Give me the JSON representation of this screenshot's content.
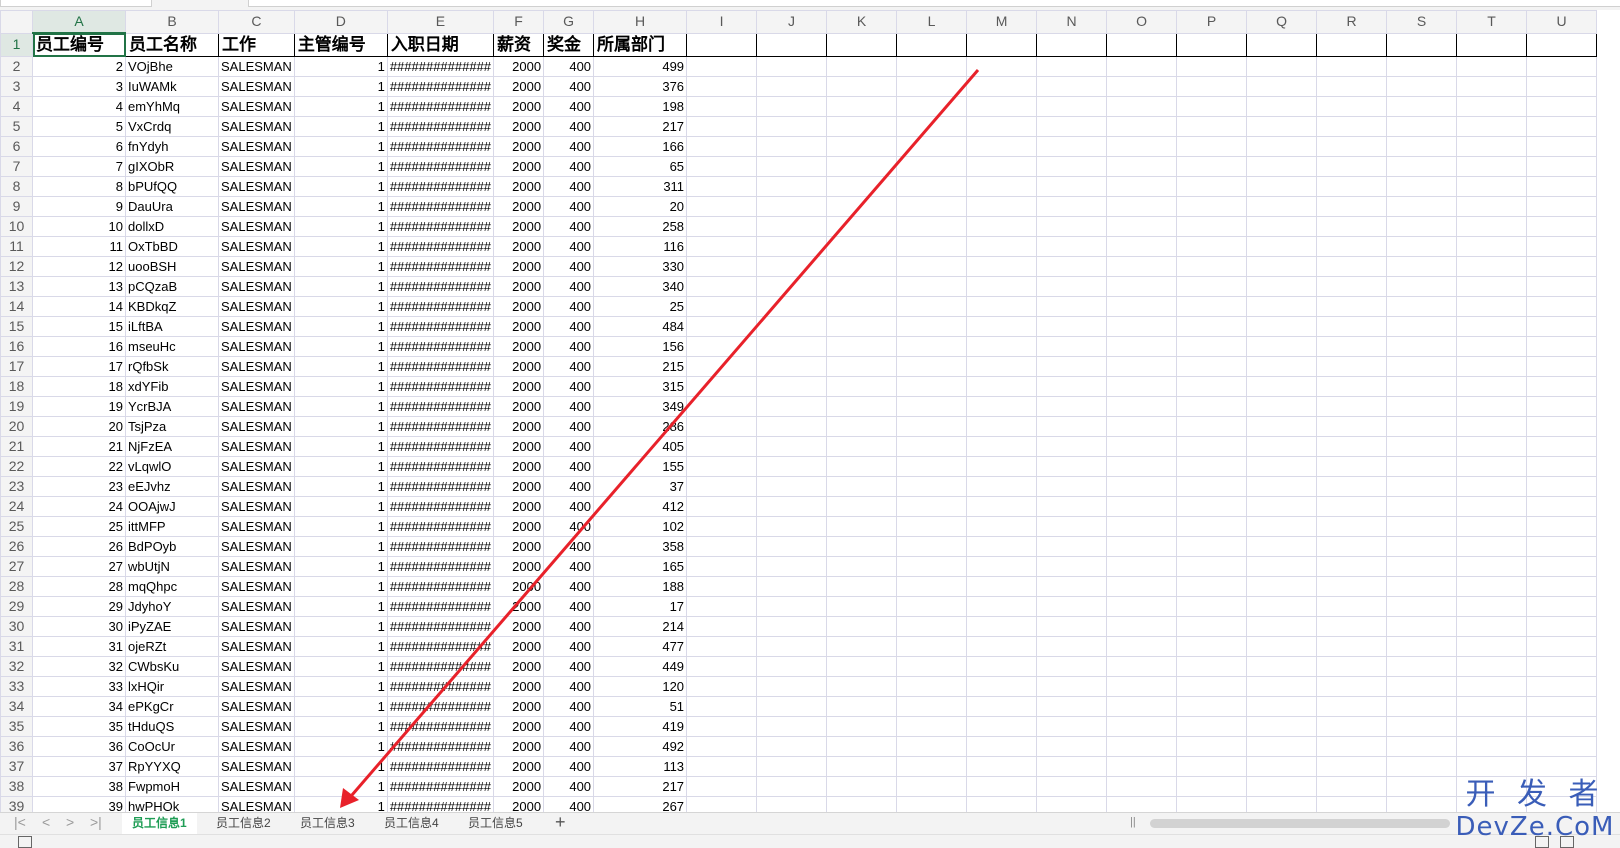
{
  "columns": [
    "A",
    "B",
    "C",
    "D",
    "E",
    "F",
    "G",
    "H",
    "I",
    "J",
    "K",
    "L",
    "M",
    "N",
    "O",
    "P",
    "Q",
    "R",
    "S",
    "T",
    "U"
  ],
  "selected_column": "A",
  "selected_row": "1",
  "header_row": [
    "员工编号",
    "员工名称",
    "工作",
    "主管编号",
    "入职日期",
    "薪资",
    "奖金",
    "所属部门"
  ],
  "rows": [
    {
      "id": "2",
      "name": "VOjBhe",
      "job": "SALESMAN",
      "mgr": "1",
      "date": "##############",
      "sal": "2000",
      "comm": "400",
      "dept": "499"
    },
    {
      "id": "3",
      "name": "IuWAMk",
      "job": "SALESMAN",
      "mgr": "1",
      "date": "##############",
      "sal": "2000",
      "comm": "400",
      "dept": "376"
    },
    {
      "id": "4",
      "name": "emYhMq",
      "job": "SALESMAN",
      "mgr": "1",
      "date": "##############",
      "sal": "2000",
      "comm": "400",
      "dept": "198"
    },
    {
      "id": "5",
      "name": "VxCrdq",
      "job": "SALESMAN",
      "mgr": "1",
      "date": "##############",
      "sal": "2000",
      "comm": "400",
      "dept": "217"
    },
    {
      "id": "6",
      "name": "fnYdyh",
      "job": "SALESMAN",
      "mgr": "1",
      "date": "##############",
      "sal": "2000",
      "comm": "400",
      "dept": "166"
    },
    {
      "id": "7",
      "name": "gIXObR",
      "job": "SALESMAN",
      "mgr": "1",
      "date": "##############",
      "sal": "2000",
      "comm": "400",
      "dept": "65"
    },
    {
      "id": "8",
      "name": "bPUfQQ",
      "job": "SALESMAN",
      "mgr": "1",
      "date": "##############",
      "sal": "2000",
      "comm": "400",
      "dept": "311"
    },
    {
      "id": "9",
      "name": "DauUra",
      "job": "SALESMAN",
      "mgr": "1",
      "date": "##############",
      "sal": "2000",
      "comm": "400",
      "dept": "20"
    },
    {
      "id": "10",
      "name": "dollxD",
      "job": "SALESMAN",
      "mgr": "1",
      "date": "##############",
      "sal": "2000",
      "comm": "400",
      "dept": "258"
    },
    {
      "id": "11",
      "name": "OxTbBD",
      "job": "SALESMAN",
      "mgr": "1",
      "date": "##############",
      "sal": "2000",
      "comm": "400",
      "dept": "116"
    },
    {
      "id": "12",
      "name": "uooBSH",
      "job": "SALESMAN",
      "mgr": "1",
      "date": "##############",
      "sal": "2000",
      "comm": "400",
      "dept": "330"
    },
    {
      "id": "13",
      "name": "pCQzaB",
      "job": "SALESMAN",
      "mgr": "1",
      "date": "##############",
      "sal": "2000",
      "comm": "400",
      "dept": "340"
    },
    {
      "id": "14",
      "name": "KBDkqZ",
      "job": "SALESMAN",
      "mgr": "1",
      "date": "##############",
      "sal": "2000",
      "comm": "400",
      "dept": "25"
    },
    {
      "id": "15",
      "name": "iLftBA",
      "job": "SALESMAN",
      "mgr": "1",
      "date": "##############",
      "sal": "2000",
      "comm": "400",
      "dept": "484"
    },
    {
      "id": "16",
      "name": "mseuHc",
      "job": "SALESMAN",
      "mgr": "1",
      "date": "##############",
      "sal": "2000",
      "comm": "400",
      "dept": "156"
    },
    {
      "id": "17",
      "name": "rQfbSk",
      "job": "SALESMAN",
      "mgr": "1",
      "date": "##############",
      "sal": "2000",
      "comm": "400",
      "dept": "215"
    },
    {
      "id": "18",
      "name": "xdYFib",
      "job": "SALESMAN",
      "mgr": "1",
      "date": "##############",
      "sal": "2000",
      "comm": "400",
      "dept": "315"
    },
    {
      "id": "19",
      "name": "YcrBJA",
      "job": "SALESMAN",
      "mgr": "1",
      "date": "##############",
      "sal": "2000",
      "comm": "400",
      "dept": "349"
    },
    {
      "id": "20",
      "name": "TsjPza",
      "job": "SALESMAN",
      "mgr": "1",
      "date": "##############",
      "sal": "2000",
      "comm": "400",
      "dept": "286"
    },
    {
      "id": "21",
      "name": "NjFzEA",
      "job": "SALESMAN",
      "mgr": "1",
      "date": "##############",
      "sal": "2000",
      "comm": "400",
      "dept": "405"
    },
    {
      "id": "22",
      "name": "vLqwlO",
      "job": "SALESMAN",
      "mgr": "1",
      "date": "##############",
      "sal": "2000",
      "comm": "400",
      "dept": "155"
    },
    {
      "id": "23",
      "name": "eEJvhz",
      "job": "SALESMAN",
      "mgr": "1",
      "date": "##############",
      "sal": "2000",
      "comm": "400",
      "dept": "37"
    },
    {
      "id": "24",
      "name": "OOAjwJ",
      "job": "SALESMAN",
      "mgr": "1",
      "date": "##############",
      "sal": "2000",
      "comm": "400",
      "dept": "412"
    },
    {
      "id": "25",
      "name": "ittMFP",
      "job": "SALESMAN",
      "mgr": "1",
      "date": "##############",
      "sal": "2000",
      "comm": "400",
      "dept": "102"
    },
    {
      "id": "26",
      "name": "BdPOyb",
      "job": "SALESMAN",
      "mgr": "1",
      "date": "##############",
      "sal": "2000",
      "comm": "400",
      "dept": "358"
    },
    {
      "id": "27",
      "name": "wbUtjN",
      "job": "SALESMAN",
      "mgr": "1",
      "date": "##############",
      "sal": "2000",
      "comm": "400",
      "dept": "165"
    },
    {
      "id": "28",
      "name": "mqQhpc",
      "job": "SALESMAN",
      "mgr": "1",
      "date": "##############",
      "sal": "2000",
      "comm": "400",
      "dept": "188"
    },
    {
      "id": "29",
      "name": "JdyhoY",
      "job": "SALESMAN",
      "mgr": "1",
      "date": "##############",
      "sal": "2000",
      "comm": "400",
      "dept": "17"
    },
    {
      "id": "30",
      "name": "iPyZAE",
      "job": "SALESMAN",
      "mgr": "1",
      "date": "##############",
      "sal": "2000",
      "comm": "400",
      "dept": "214"
    },
    {
      "id": "31",
      "name": "ojeRZt",
      "job": "SALESMAN",
      "mgr": "1",
      "date": "##############",
      "sal": "2000",
      "comm": "400",
      "dept": "477"
    },
    {
      "id": "32",
      "name": "CWbsKu",
      "job": "SALESMAN",
      "mgr": "1",
      "date": "##############",
      "sal": "2000",
      "comm": "400",
      "dept": "449"
    },
    {
      "id": "33",
      "name": "lxHQir",
      "job": "SALESMAN",
      "mgr": "1",
      "date": "##############",
      "sal": "2000",
      "comm": "400",
      "dept": "120"
    },
    {
      "id": "34",
      "name": "ePKgCr",
      "job": "SALESMAN",
      "mgr": "1",
      "date": "##############",
      "sal": "2000",
      "comm": "400",
      "dept": "51"
    },
    {
      "id": "35",
      "name": "tHduQS",
      "job": "SALESMAN",
      "mgr": "1",
      "date": "##############",
      "sal": "2000",
      "comm": "400",
      "dept": "419"
    },
    {
      "id": "36",
      "name": "CoOcUr",
      "job": "SALESMAN",
      "mgr": "1",
      "date": "##############",
      "sal": "2000",
      "comm": "400",
      "dept": "492"
    },
    {
      "id": "37",
      "name": "RpYYXQ",
      "job": "SALESMAN",
      "mgr": "1",
      "date": "##############",
      "sal": "2000",
      "comm": "400",
      "dept": "113"
    },
    {
      "id": "38",
      "name": "FwpmoH",
      "job": "SALESMAN",
      "mgr": "1",
      "date": "##############",
      "sal": "2000",
      "comm": "400",
      "dept": "217"
    },
    {
      "id": "39",
      "name": "hwPHOk",
      "job": "SALESMAN",
      "mgr": "1",
      "date": "##############",
      "sal": "2000",
      "comm": "400",
      "dept": "267"
    }
  ],
  "sheet_tabs": [
    {
      "label": "员工信息1",
      "active": true
    },
    {
      "label": "员工信息2",
      "active": false
    },
    {
      "label": "员工信息3",
      "active": false
    },
    {
      "label": "员工信息4",
      "active": false
    },
    {
      "label": "员工信息5",
      "active": false
    }
  ],
  "tabbar": {
    "nav_first": "|<",
    "nav_prev": "<",
    "nav_next": ">",
    "nav_last": ">|",
    "add_sheet": "+",
    "scroll_grip": "||"
  },
  "annotation": {
    "arrow_color": "#e8212a"
  },
  "watermark": {
    "line1": "开 发 者",
    "line2": "DevZe.CoM"
  },
  "colors": {
    "selection": "#217346",
    "active_tab": "#1f9d55",
    "watermark": "#3a5db8"
  }
}
